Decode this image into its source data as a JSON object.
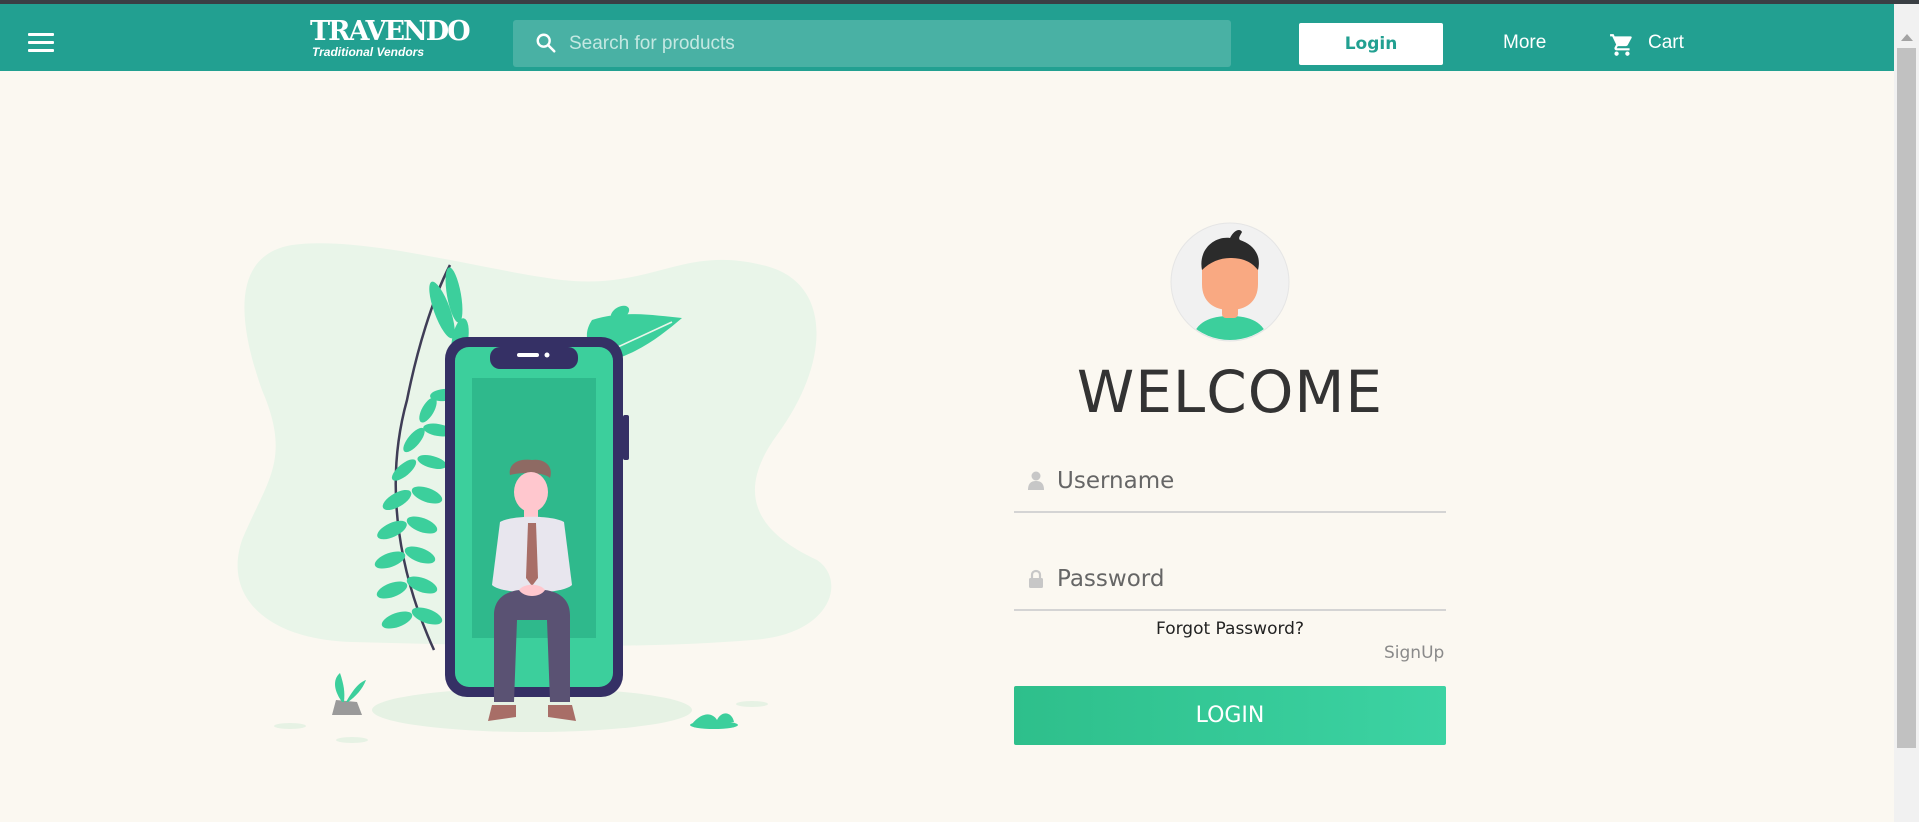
{
  "header": {
    "logo_main": "TRAVENDO",
    "logo_sub": "Traditional Vendors",
    "search_placeholder": "Search for products",
    "login_button": "Login",
    "more_label": "More",
    "cart_label": "Cart"
  },
  "login_form": {
    "title": "WELCOME",
    "username_placeholder": "Username",
    "password_placeholder": "Password",
    "forgot_password": "Forgot Password?",
    "signup_link": "SignUp",
    "submit_button": "LOGIN"
  },
  "icons": [
    "menu-icon",
    "search-icon",
    "cart-icon",
    "user-icon",
    "lock-icon"
  ],
  "colors": {
    "brand": "#22a091",
    "background": "#fbf8f1",
    "accent_green": "#3ccf9c",
    "phone_frame": "#353065"
  }
}
